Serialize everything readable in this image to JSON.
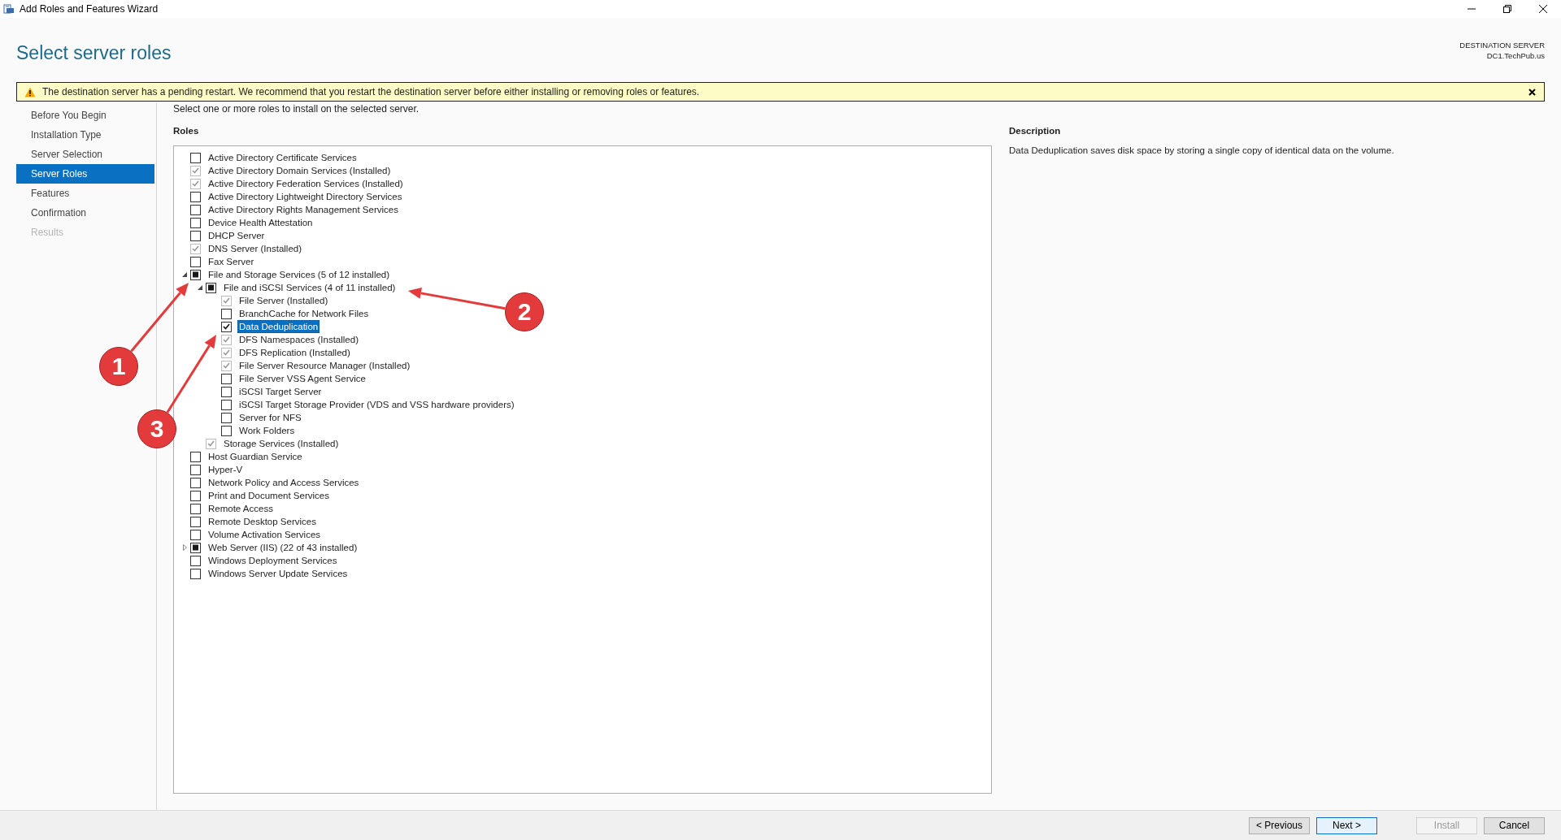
{
  "window": {
    "title": "Add Roles and Features Wizard"
  },
  "header": {
    "title": "Select server roles",
    "destination_label": "DESTINATION SERVER",
    "destination_server": "DC1.TechPub.us"
  },
  "warning": {
    "message": "The destination server has a pending restart. We recommend that you restart the destination server before either installing or removing roles or features."
  },
  "steps": [
    {
      "label": "Before You Begin",
      "selected": false,
      "disabled": false
    },
    {
      "label": "Installation Type",
      "selected": false,
      "disabled": false
    },
    {
      "label": "Server Selection",
      "selected": false,
      "disabled": false
    },
    {
      "label": "Server Roles",
      "selected": true,
      "disabled": false
    },
    {
      "label": "Features",
      "selected": false,
      "disabled": false
    },
    {
      "label": "Confirmation",
      "selected": false,
      "disabled": false
    },
    {
      "label": "Results",
      "selected": false,
      "disabled": true
    }
  ],
  "intro": "Select one or more roles to install on the selected server.",
  "roles": {
    "heading": "Roles",
    "items": [
      {
        "label": "Active Directory Certificate Services",
        "checked": false,
        "disabled": false,
        "selected": false
      },
      {
        "label": "Active Directory Domain Services (Installed)",
        "checked": true,
        "disabled": true,
        "selected": false
      },
      {
        "label": "Active Directory Federation Services (Installed)",
        "checked": true,
        "disabled": true,
        "selected": false
      },
      {
        "label": "Active Directory Lightweight Directory Services",
        "checked": false,
        "disabled": false,
        "selected": false
      },
      {
        "label": "Active Directory Rights Management Services",
        "checked": false,
        "disabled": false,
        "selected": false
      },
      {
        "label": "Device Health Attestation",
        "checked": false,
        "disabled": false,
        "selected": false
      },
      {
        "label": "DHCP Server",
        "checked": false,
        "disabled": false,
        "selected": false
      },
      {
        "label": "DNS Server (Installed)",
        "checked": true,
        "disabled": true,
        "selected": false
      },
      {
        "label": "Fax Server",
        "checked": false,
        "disabled": false,
        "selected": false
      },
      {
        "label": "File and Storage Services (5 of 12 installed)",
        "checked": false,
        "indeterminate": true,
        "disabled": false,
        "selected": false,
        "expanded": true,
        "children": [
          {
            "label": "File and iSCSI Services (4 of 11 installed)",
            "checked": false,
            "indeterminate": true,
            "disabled": false,
            "selected": false,
            "expanded": true,
            "children": [
              {
                "label": "File Server (Installed)",
                "checked": true,
                "disabled": true,
                "selected": false
              },
              {
                "label": "BranchCache for Network Files",
                "checked": false,
                "disabled": false,
                "selected": false
              },
              {
                "label": "Data Deduplication",
                "checked": true,
                "disabled": false,
                "selected": true
              },
              {
                "label": "DFS Namespaces (Installed)",
                "checked": true,
                "disabled": true,
                "selected": false
              },
              {
                "label": "DFS Replication (Installed)",
                "checked": true,
                "disabled": true,
                "selected": false
              },
              {
                "label": "File Server Resource Manager (Installed)",
                "checked": true,
                "disabled": true,
                "selected": false
              },
              {
                "label": "File Server VSS Agent Service",
                "checked": false,
                "disabled": false,
                "selected": false
              },
              {
                "label": "iSCSI Target Server",
                "checked": false,
                "disabled": false,
                "selected": false
              },
              {
                "label": "iSCSI Target Storage Provider (VDS and VSS hardware providers)",
                "checked": false,
                "disabled": false,
                "selected": false
              },
              {
                "label": "Server for NFS",
                "checked": false,
                "disabled": false,
                "selected": false
              },
              {
                "label": "Work Folders",
                "checked": false,
                "disabled": false,
                "selected": false
              }
            ]
          },
          {
            "label": "Storage Services (Installed)",
            "checked": true,
            "disabled": true,
            "selected": false
          }
        ]
      },
      {
        "label": "Host Guardian Service",
        "checked": false,
        "disabled": false,
        "selected": false
      },
      {
        "label": "Hyper-V",
        "checked": false,
        "disabled": false,
        "selected": false
      },
      {
        "label": "Network Policy and Access Services",
        "checked": false,
        "disabled": false,
        "selected": false
      },
      {
        "label": "Print and Document Services",
        "checked": false,
        "disabled": false,
        "selected": false
      },
      {
        "label": "Remote Access",
        "checked": false,
        "disabled": false,
        "selected": false
      },
      {
        "label": "Remote Desktop Services",
        "checked": false,
        "disabled": false,
        "selected": false
      },
      {
        "label": "Volume Activation Services",
        "checked": false,
        "disabled": false,
        "selected": false
      },
      {
        "label": "Web Server (IIS) (22 of 43 installed)",
        "checked": false,
        "indeterminate": true,
        "disabled": false,
        "selected": false,
        "expanded": false
      },
      {
        "label": "Windows Deployment Services",
        "checked": false,
        "disabled": false,
        "selected": false
      },
      {
        "label": "Windows Server Update Services",
        "checked": false,
        "disabled": false,
        "selected": false
      }
    ]
  },
  "description": {
    "heading": "Description",
    "text": "Data Deduplication saves disk space by storing a single copy of identical data on the volume."
  },
  "buttons": [
    {
      "label": "< Previous",
      "kind": "normal"
    },
    {
      "label": "Next >",
      "kind": "focused"
    },
    {
      "label": "Install",
      "kind": "disabled"
    },
    {
      "label": "Cancel",
      "kind": "normal"
    }
  ],
  "annotations": [
    {
      "number": "1"
    },
    {
      "number": "2"
    },
    {
      "number": "3"
    }
  ]
}
